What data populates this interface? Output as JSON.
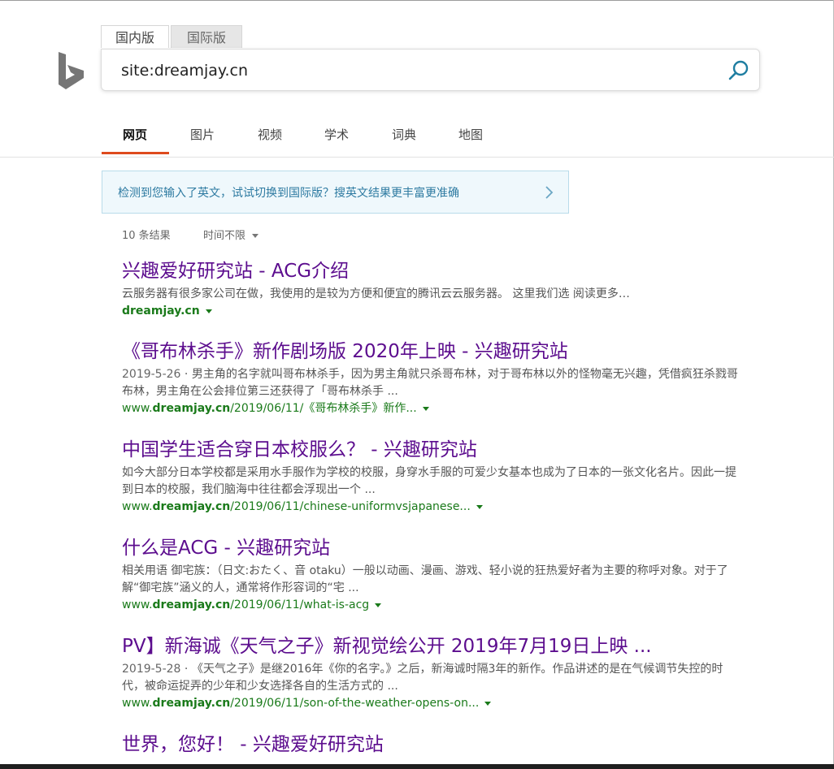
{
  "brand": {
    "logo": "bing-logo",
    "accent": "#de4a1d",
    "link_color": "#5c0d8e",
    "url_color": "#1a7a1a"
  },
  "search": {
    "market_tabs": [
      "国内版",
      "国际版"
    ],
    "query": "site:dreamjay.cn",
    "button_icon": "search-icon"
  },
  "nav": {
    "items": [
      "网页",
      "图片",
      "视频",
      "学术",
      "词典",
      "地图"
    ],
    "active": "网页"
  },
  "suggestion": {
    "text": "检测到您输入了英文，试试切换到国际版？搜英文结果更丰富更准确",
    "icon": "chevron-right-icon"
  },
  "meta": {
    "count": "10 条结果",
    "time_filter": "时间不限"
  },
  "results": [
    {
      "title": "兴趣爱好研究站 - ACG介绍",
      "date": "",
      "snippet": "云服务器有很多家公司在做，我使用的是较为方便和便宜的腾讯云云服务器。 这里我们选 阅读更多…",
      "url_prefix": "",
      "url_domain": "dreamjay.cn",
      "url_path": ""
    },
    {
      "title": "《哥布林杀手》新作剧场版 2020年上映 - 兴趣研究站",
      "date": "2019-5-26",
      "snippet": "男主角的名字就叫哥布林杀手，因为男主角就只杀哥布林，对于哥布林以外的怪物毫无兴趣，凭借疯狂杀戮哥布林，男主角在公会排位第三还获得了「哥布林杀手 ...",
      "url_prefix": "www.",
      "url_domain": "dreamjay.cn",
      "url_path": "/2019/06/11/《哥布林杀手》新作..."
    },
    {
      "title": "中国学生适合穿日本校服么？ - 兴趣研究站",
      "date": "",
      "snippet": "如今大部分日本学校都是采用水手服作为学校的校服，身穿水手服的可爱少女基本也成为了日本的一张文化名片。因此一提到日本的校服，我们脑海中往往都会浮现出一个 ...",
      "url_prefix": "www.",
      "url_domain": "dreamjay.cn",
      "url_path": "/2019/06/11/chinese-uniformvsjapanese..."
    },
    {
      "title": "什么是ACG - 兴趣研究站",
      "date": "",
      "snippet": "相关用语 御宅族：（日文:おたく、音 otaku）一般以动画、漫画、游戏、轻小说的狂热爱好者为主要的称呼对象。对于了解“御宅族”涵义的人，通常将作形容词的“宅 ...",
      "url_prefix": "www.",
      "url_domain": "dreamjay.cn",
      "url_path": "/2019/06/11/what-is-acg"
    },
    {
      "title": "PV】新海诚《天气之子》新视觉绘公开 2019年7月19日上映 ...",
      "date": "2019-5-28",
      "snippet": "《天气之子》是继2016年《你的名字。》之后，新海诚时隔3年的新作。作品讲述的是在气候调节失控的时代，被命运捉弄的少年和少女选择各自的生活方式的 ...",
      "url_prefix": "www.",
      "url_domain": "dreamjay.cn",
      "url_path": "/2019/06/11/son-of-the-weather-opens-on..."
    },
    {
      "title": "世界，您好！ - 兴趣爱好研究站",
      "date": "",
      "snippet": "",
      "url_prefix": "",
      "url_domain": "",
      "url_path": ""
    }
  ]
}
